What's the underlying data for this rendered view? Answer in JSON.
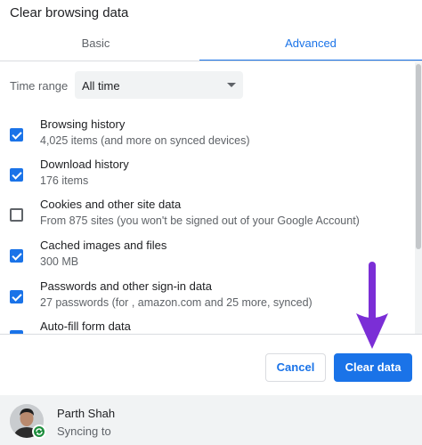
{
  "dialog": {
    "title": "Clear browsing data"
  },
  "tabs": [
    {
      "label": "Basic",
      "active": false
    },
    {
      "label": "Advanced",
      "active": true
    }
  ],
  "time_range": {
    "label": "Time range",
    "value": "All time"
  },
  "items": [
    {
      "title": "Browsing history",
      "description": "4,025 items (and more on synced devices)",
      "checked": true
    },
    {
      "title": "Download history",
      "description": "176 items",
      "checked": true
    },
    {
      "title": "Cookies and other site data",
      "description": "From 875 sites (you won't be signed out of your Google Account)",
      "checked": false
    },
    {
      "title": "Cached images and files",
      "description": "300 MB",
      "checked": true
    },
    {
      "title": "Passwords and other sign-in data",
      "description": "27 passwords (for , amazon.com and 25 more, synced)",
      "checked": true
    },
    {
      "title": "Auto-fill form data",
      "description": "",
      "checked": true
    }
  ],
  "buttons": {
    "cancel": "Cancel",
    "clear": "Clear data"
  },
  "account": {
    "name": "Parth Shah",
    "status": "Syncing to"
  },
  "colors": {
    "accent": "#1a73e8",
    "annotation_arrow": "#7b2ed6",
    "sync_badge": "#1e8e3e"
  },
  "icons": {
    "dropdown": "chevron-down-icon",
    "checkbox_checked": "checkbox-checked-icon",
    "checkbox_unchecked": "checkbox-unchecked-icon",
    "sync": "sync-icon",
    "annotation": "arrow-down-icon"
  }
}
